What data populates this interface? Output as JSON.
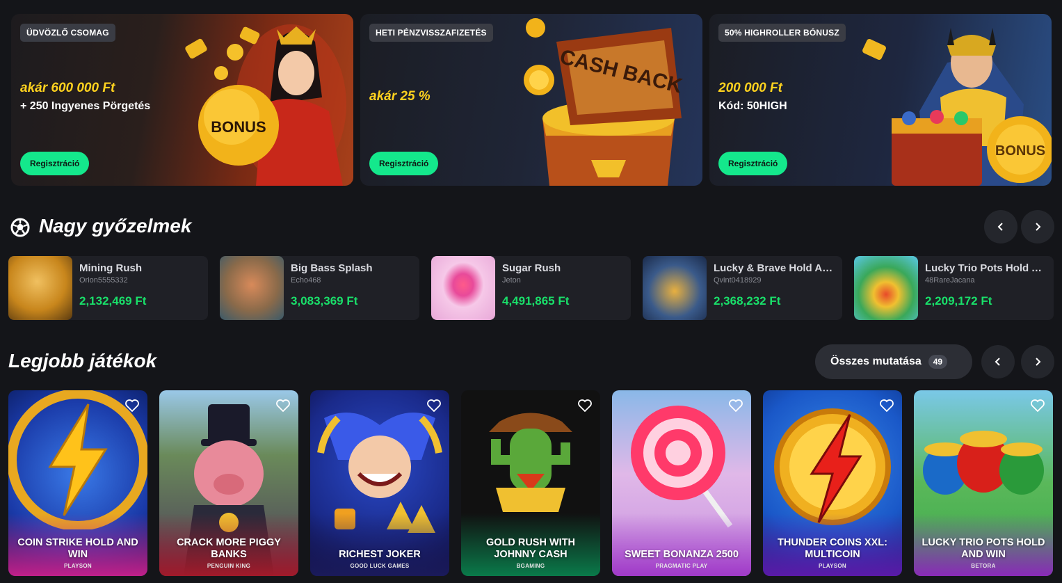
{
  "banners": [
    {
      "tag": "ÜDVÖZLŐ CSOMAG",
      "title": "akár 600 000 Ft",
      "subtitle": "+ 250 Ingyenes Pörgetés",
      "button": "Regisztráció",
      "art_text": "BONUS"
    },
    {
      "tag": "HETI PÉNZVISSZAFIZETÉS",
      "title": "akár 25 %",
      "subtitle": "",
      "button": "Regisztráció",
      "art_text": "CASH BACK"
    },
    {
      "tag": "50% HIGHROLLER BÓNUSZ",
      "title": "200 000 Ft",
      "subtitle": "Kód: 50HIGH",
      "button": "Regisztráció",
      "art_text": "BONUS"
    }
  ],
  "big_wins": {
    "title": "Nagy győzelmek",
    "icon": "soccer-ball-icon",
    "prev_icon": "chevron-left-icon",
    "next_icon": "chevron-right-icon",
    "items": [
      {
        "game": "Mining Rush",
        "user": "Orion5555332",
        "amount": "2,132,469 Ft",
        "color": "#c8861c"
      },
      {
        "game": "Big Bass Splash",
        "user": "Echo468",
        "amount": "3,083,369 Ft",
        "color": "#8a6a4a"
      },
      {
        "game": "Sugar Rush",
        "user": "Jeton",
        "amount": "4,491,865 Ft",
        "color": "#f0a8d8"
      },
      {
        "game": "Lucky & Brave Hold And Win",
        "user": "Qvint0418929",
        "amount": "2,368,232 Ft",
        "color": "#3a5a8a"
      },
      {
        "game": "Lucky Trio Pots Hold And Win",
        "user": "48RareJacana",
        "amount": "2,209,172 Ft",
        "color": "#3aa85a"
      }
    ]
  },
  "top_games": {
    "title": "Legjobb játékok",
    "show_all_label": "Összes mutatása",
    "show_all_count": "49",
    "items": [
      {
        "title": "COIN STRIKE HOLD AND WIN",
        "provider": "PLAYSON",
        "bg": "#1a3aa8",
        "accent": "#ffc21a",
        "glow": "#c0208a"
      },
      {
        "title": "CRACK MORE PIGGY BANKS",
        "provider": "PENGUIN KING",
        "bg": "#5a6a3a",
        "accent": "#e88a9a",
        "glow": "#a01a2a"
      },
      {
        "title": "RICHEST JOKER",
        "provider": "GOOD LUCK GAMES",
        "bg": "#1a2a8a",
        "accent": "#ffcc33",
        "glow": "#1a1a5a"
      },
      {
        "title": "GOLD RUSH WITH JOHNNY CASH",
        "provider": "BGAMING",
        "bg": "#111111",
        "accent": "#5aa83a",
        "glow": "#0a7a4a"
      },
      {
        "title": "SWEET BONANZA 2500",
        "provider": "PRAGMATIC PLAY",
        "bg": "#c890e0",
        "accent": "#ff3a6a",
        "glow": "#a03ac8"
      },
      {
        "title": "THUNDER COINS XXL: MULTICOIN",
        "provider": "PLAYSON",
        "bg": "#1a58c8",
        "accent": "#ff3a1a",
        "glow": "#5a1aa8"
      },
      {
        "title": "LUCKY TRIO POTS HOLD AND WIN",
        "provider": "BETORA",
        "bg": "#3aa84a",
        "accent": "#e84a2a",
        "glow": "#8a2ab8"
      }
    ]
  }
}
